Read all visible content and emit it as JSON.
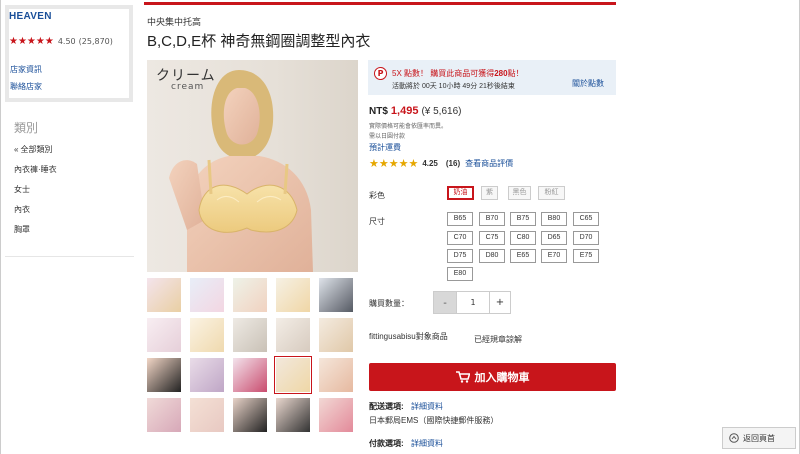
{
  "shop": {
    "name": "HEAVEN",
    "stars": "★★★★★",
    "rating": "4.50",
    "rating_count": "(25,870)",
    "shop_info_link": "店家資訊",
    "contact_link": "聯絡店家"
  },
  "categories": {
    "title": "類別",
    "items": [
      "全部類別",
      "內衣褲·睡衣",
      "女士",
      "內衣",
      "胸罩"
    ]
  },
  "product": {
    "ship_from": "中央集中托高",
    "title": "B,C,D,E杯 神奇無鋼圈調整型內衣",
    "image_text_jp": "クリーム",
    "image_text_en": "cream"
  },
  "points": {
    "badge": "P",
    "line1_prefix": "5X 點數！ 購買此商品可獲得",
    "line1_points": "280",
    "line1_suffix": "點！",
    "line2": "活動將於 00天 10小時 49分 21秒後結束",
    "link": "關於點數"
  },
  "price": {
    "label": "NT$",
    "value": "1,495",
    "jpy": "(¥ 5,616)",
    "note1": "實際價格可能會依匯率而異。",
    "note2": "需以日圓付款",
    "shipping_fee_link": "預計運費"
  },
  "review": {
    "stars": "★★★★★",
    "score": "4.25",
    "count": "(16)",
    "link": "查看商品評價"
  },
  "options": {
    "color_label": "彩色",
    "colors": [
      "奶油",
      "紫",
      "黑色",
      "粉紅"
    ],
    "color_selected": "奶油",
    "size_label": "尺寸",
    "sizes": [
      "B65",
      "B70",
      "B75",
      "B80",
      "C65",
      "C70",
      "C75",
      "C80",
      "D65",
      "D70",
      "D75",
      "D80",
      "E65",
      "E70",
      "E75",
      "E80"
    ],
    "qty_label": "購買數量：",
    "qty_minus": "-",
    "qty_value": "1",
    "qty_plus": "+",
    "fitting_label": "fittingusabisu對象商品",
    "fitting_value": "已經規章諒解"
  },
  "cart": {
    "button": "加入購物車"
  },
  "delivery": {
    "label": "配送選項:",
    "link": "詳細資料",
    "value": "日本郵局EMS（國際快捷郵件服務）"
  },
  "payment": {
    "label": "付款選項:",
    "link": "詳細資料"
  },
  "back_to_top": "返回頁首",
  "colors": {
    "accent": "#c8151b",
    "link": "#1a4f99",
    "star": "#e6a700",
    "point_bg": "#e9f0f7"
  }
}
